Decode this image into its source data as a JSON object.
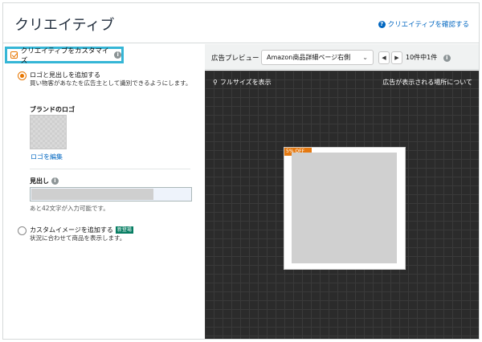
{
  "header": {
    "title": "クリエイティブ",
    "confirm_link": "クリエイティブを確認する"
  },
  "left": {
    "customize_label": "クリエイティブをカスタマイズ",
    "option_logo": {
      "label": "ロゴと見出しを追加する",
      "description": "買い物客があなたを広告主として識別できるようにします。"
    },
    "brand_logo_heading": "ブランドのロゴ",
    "edit_logo_link": "ロゴを編集",
    "headline_heading": "見出し",
    "char_count": "あと42文字が入力可能です。",
    "option_custom_image": {
      "label": "カスタムイメージを追加する",
      "badge": "新登場",
      "description": "状況に合わせて商品を表示します。"
    }
  },
  "preview": {
    "label": "広告プレビュー",
    "placement_selected": "Amazon商品詳細ページ右側",
    "count": "10件中1件",
    "fullsize": "フルサイズを表示",
    "where_link": "広告が表示される場所について",
    "ad_tag": "5% OFF"
  },
  "colors": {
    "highlight": "#35b6d6",
    "accent": "#e77600",
    "link": "#0066c0"
  }
}
